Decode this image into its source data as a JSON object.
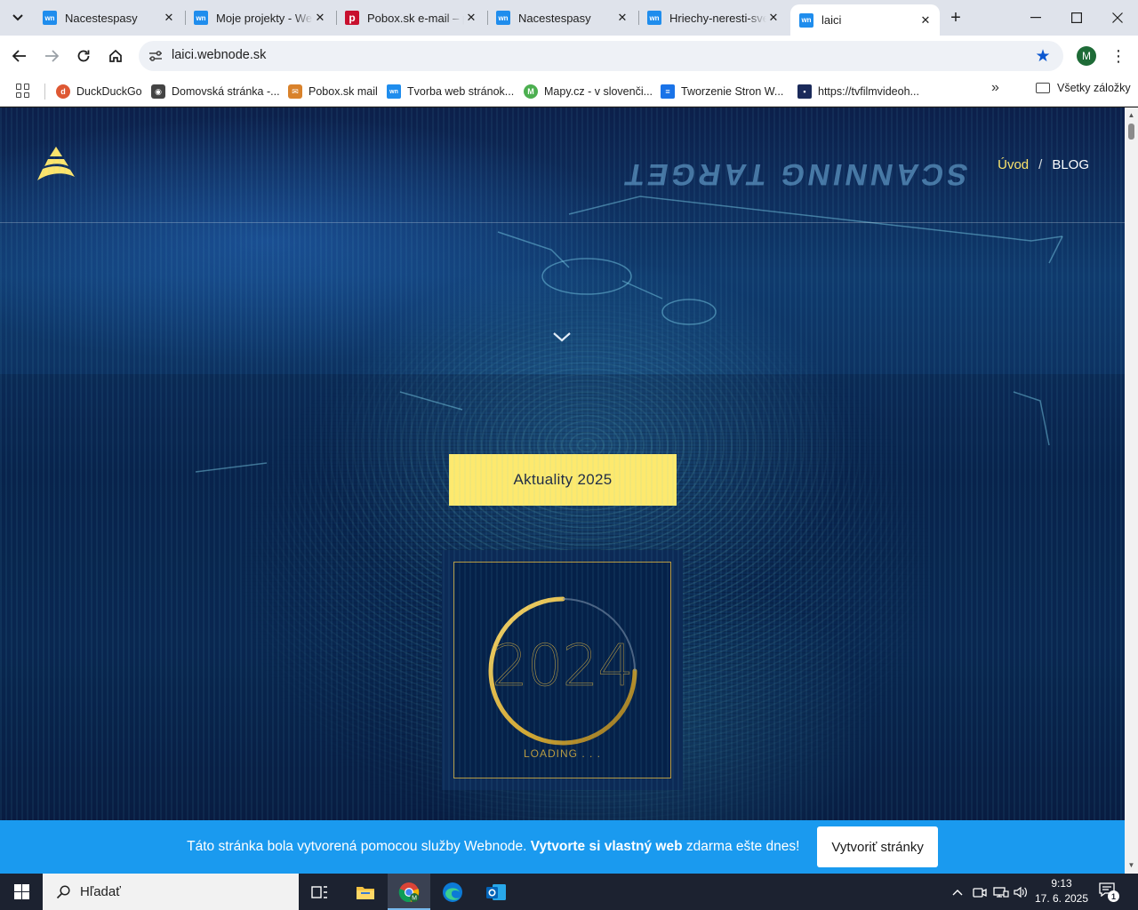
{
  "browser": {
    "tabs": [
      {
        "title": "Nacestespasy",
        "favicon": "webnode-icon",
        "active": false
      },
      {
        "title": "Moje projekty - Webnode",
        "favicon": "webnode-icon",
        "active": false
      },
      {
        "title": "Pobox.sk e-mail – pošta",
        "favicon": "pobox-icon",
        "active": false
      },
      {
        "title": "Nacestespasy",
        "favicon": "webnode-icon",
        "active": false
      },
      {
        "title": "Hriechy-neresti-svet",
        "favicon": "webnode-icon",
        "active": false
      },
      {
        "title": "laici",
        "favicon": "webnode-icon",
        "active": true
      }
    ],
    "address": "laici.webnode.sk",
    "profile_initial": "M",
    "bookmarks": [
      {
        "label": "DuckDuckGo",
        "icon": "duckduckgo-icon",
        "color": "#de5833"
      },
      {
        "label": "Domovská stránka -...",
        "icon": "raccoon-icon",
        "color": "#444444"
      },
      {
        "label": "Pobox.sk mail",
        "icon": "pobox-icon",
        "color": "#d9822b"
      },
      {
        "label": "Tvorba web stránok...",
        "icon": "webnode-icon",
        "color": "#1f8ded"
      },
      {
        "label": "Mapy.cz - v slovenči...",
        "icon": "mapy-icon",
        "color": "#4caf50"
      },
      {
        "label": "Tworzenie Stron W...",
        "icon": "document-icon",
        "color": "#1a73e8"
      },
      {
        "label": "https://tvfilmvideoh...",
        "icon": "image-icon",
        "color": "#1a2a5a"
      }
    ],
    "all_bookmarks_label": "Všetky záložky"
  },
  "site": {
    "nav": {
      "home": "Úvod",
      "separator": "/",
      "blog": "BLOG"
    },
    "hud_text": "SCANNING TARGET",
    "cta_label": "Aktuality 2025",
    "card": {
      "year": "2024",
      "loading": "LOADING . . ."
    },
    "accent_color": "#fde96e"
  },
  "ad_banner": {
    "text_before": "Táto stránka bola vytvorená pomocou služby Webnode. ",
    "text_bold": "Vytvorte si vlastný web",
    "text_after": " zdarma ešte dnes!",
    "button_label": "Vytvoriť stránky"
  },
  "taskbar": {
    "search_placeholder": "Hľadať",
    "time": "9:13",
    "date": "17. 6. 2025",
    "notification_count": "1"
  }
}
